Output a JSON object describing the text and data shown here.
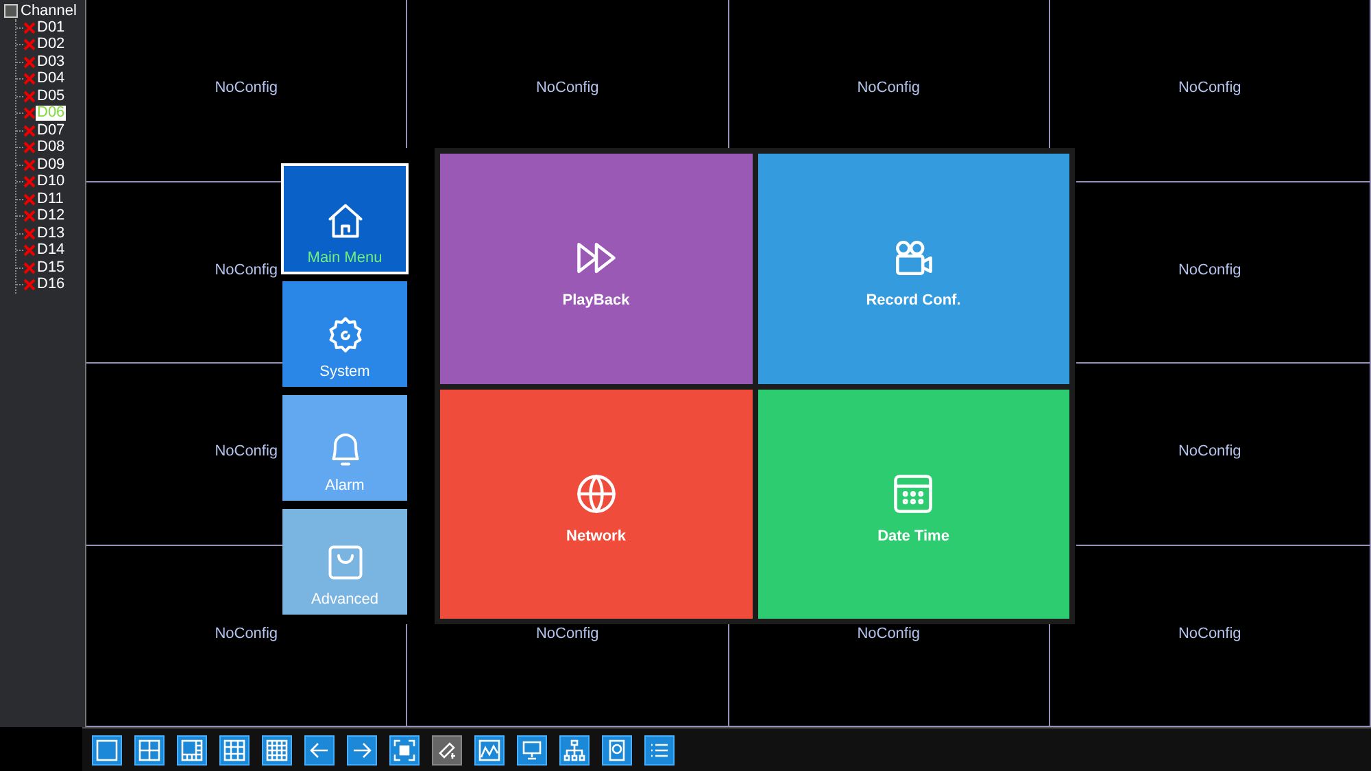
{
  "channel_tree": {
    "label": "Channel",
    "children": [
      {
        "label": "D01",
        "selected": false
      },
      {
        "label": "D02",
        "selected": false
      },
      {
        "label": "D03",
        "selected": false
      },
      {
        "label": "D04",
        "selected": false
      },
      {
        "label": "D05",
        "selected": false
      },
      {
        "label": "D06",
        "selected": true
      },
      {
        "label": "D07",
        "selected": false
      },
      {
        "label": "D08",
        "selected": false
      },
      {
        "label": "D09",
        "selected": false
      },
      {
        "label": "D10",
        "selected": false
      },
      {
        "label": "D11",
        "selected": false
      },
      {
        "label": "D12",
        "selected": false
      },
      {
        "label": "D13",
        "selected": false
      },
      {
        "label": "D14",
        "selected": false
      },
      {
        "label": "D15",
        "selected": false
      },
      {
        "label": "D16",
        "selected": false
      }
    ]
  },
  "video_grid": [
    {
      "label": "NoConfig"
    },
    {
      "label": "NoConfig"
    },
    {
      "label": "NoConfig"
    },
    {
      "label": "NoConfig"
    },
    {
      "label": "NoConfig"
    },
    {
      "label": "NoConfig"
    },
    {
      "label": "NoConfig"
    },
    {
      "label": "NoConfig"
    },
    {
      "label": "NoConfig"
    },
    {
      "label": "NoConfig"
    },
    {
      "label": "NoConfig"
    },
    {
      "label": "NoConfig"
    }
  ],
  "menu": {
    "side_items": [
      {
        "label": "Main Menu",
        "selected": true,
        "color": "#0a62c8"
      },
      {
        "label": "System",
        "selected": false,
        "color": "#2a87e8"
      },
      {
        "label": "Alarm",
        "selected": false,
        "color": "#62a8f0"
      },
      {
        "label": "Advanced",
        "selected": false,
        "color": "#7ab4e0"
      }
    ],
    "tiles": [
      {
        "label": "PlayBack",
        "color": "#9b59b6"
      },
      {
        "label": "Record Conf.",
        "color": "#349bdf"
      },
      {
        "label": "Network",
        "color": "#ef4c3b"
      },
      {
        "label": "Date Time",
        "color": "#2ecc71"
      }
    ]
  },
  "toolbar": [
    {
      "disabled": false
    },
    {
      "disabled": false
    },
    {
      "disabled": false
    },
    {
      "disabled": false
    },
    {
      "disabled": false
    },
    {
      "disabled": false
    },
    {
      "disabled": false
    },
    {
      "disabled": false
    },
    {
      "disabled": true
    },
    {
      "disabled": false
    },
    {
      "disabled": false
    },
    {
      "disabled": false
    },
    {
      "disabled": false
    },
    {
      "disabled": false
    }
  ]
}
